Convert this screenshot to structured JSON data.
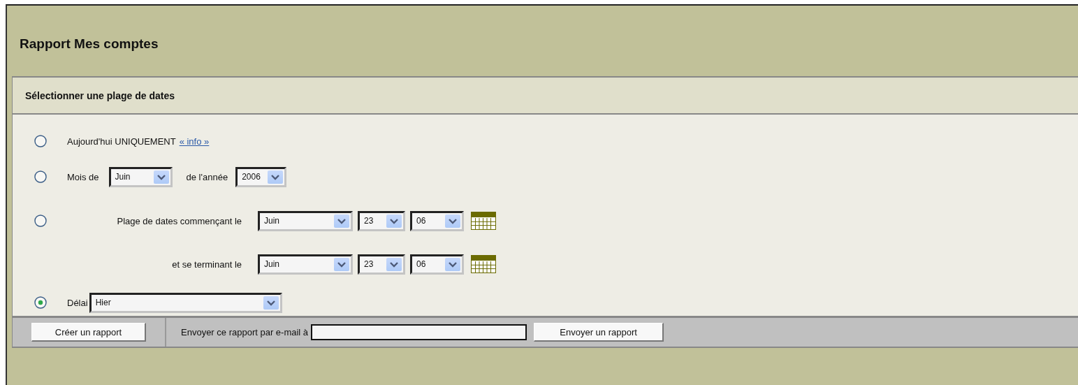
{
  "title": "Rapport Mes comptes",
  "section": {
    "title": "Sélectionner une plage de dates"
  },
  "options": [
    {
      "kind": "today",
      "selected": false,
      "label": "Aujourd'hui UNIQUEMENT",
      "link": "« info »"
    },
    {
      "kind": "month",
      "selected": false,
      "label": "Mois de",
      "month": "Juin",
      "year_label": "de l'année",
      "year": "2006"
    },
    {
      "kind": "range",
      "selected": false,
      "start_label": "Plage de dates commençant le",
      "start": [
        "Juin",
        "23",
        "06"
      ],
      "end_label": "et se terminant le",
      "end": [
        "Juin",
        "23",
        "06"
      ]
    },
    {
      "kind": "period",
      "selected": true,
      "label": "Délai",
      "value": "Hier"
    }
  ],
  "footer": {
    "create_button": "Créer un rapport",
    "email_label": "Envoyer ce rapport par e-mail à",
    "send_button": "Envoyer un rapport"
  }
}
